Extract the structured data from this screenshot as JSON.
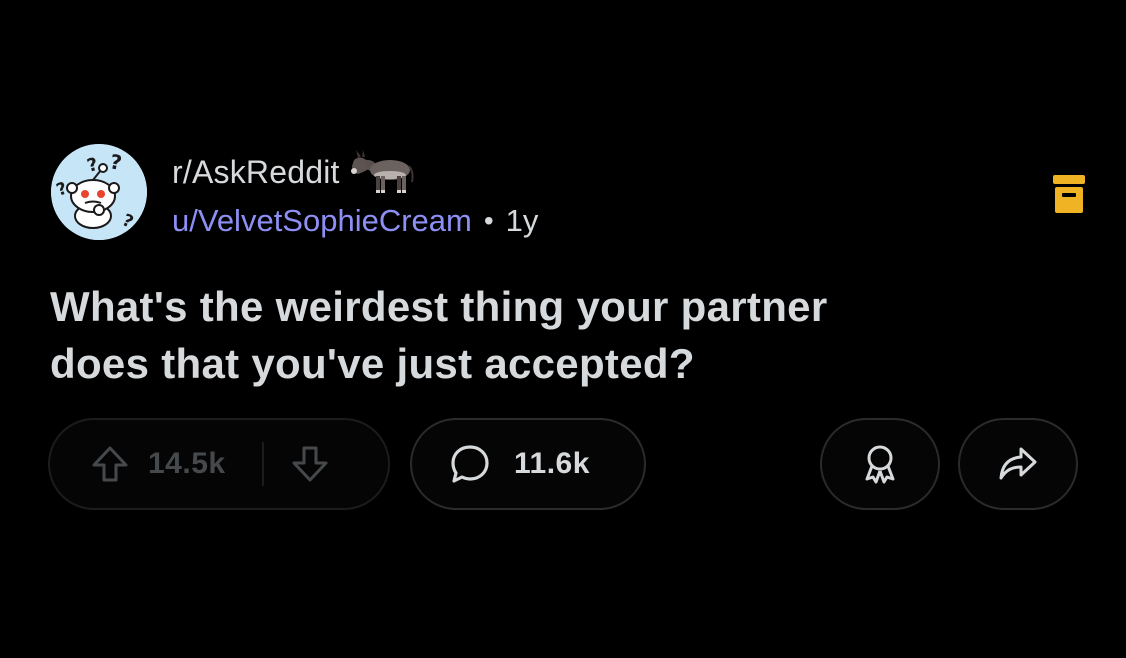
{
  "post": {
    "subreddit": "r/AskReddit",
    "username": "u/VelvetSophieCream",
    "separator": "•",
    "age": "1y",
    "title_line1": "What's the weirdest thing your partner",
    "title_line2": "does that you've just accepted?"
  },
  "actions": {
    "upvote_count": "14.5k",
    "comment_count": "11.6k"
  },
  "icons": {
    "avatar": "askreddit-snoo-avatar",
    "flair": "donkey-flair-icon",
    "archive": "archive-icon",
    "upvote": "upvote-arrow-icon",
    "downvote": "downvote-arrow-icon",
    "comment": "comment-bubble-icon",
    "award": "award-icon",
    "share": "share-arrow-icon"
  },
  "colors": {
    "background": "#000000",
    "text": "#d7dadc",
    "username": "#8e8ff5",
    "archive": "#f0b323",
    "muted": "#45494c",
    "avatar_bg": "#c6e5f7",
    "snoo_eye": "#e8442e"
  }
}
